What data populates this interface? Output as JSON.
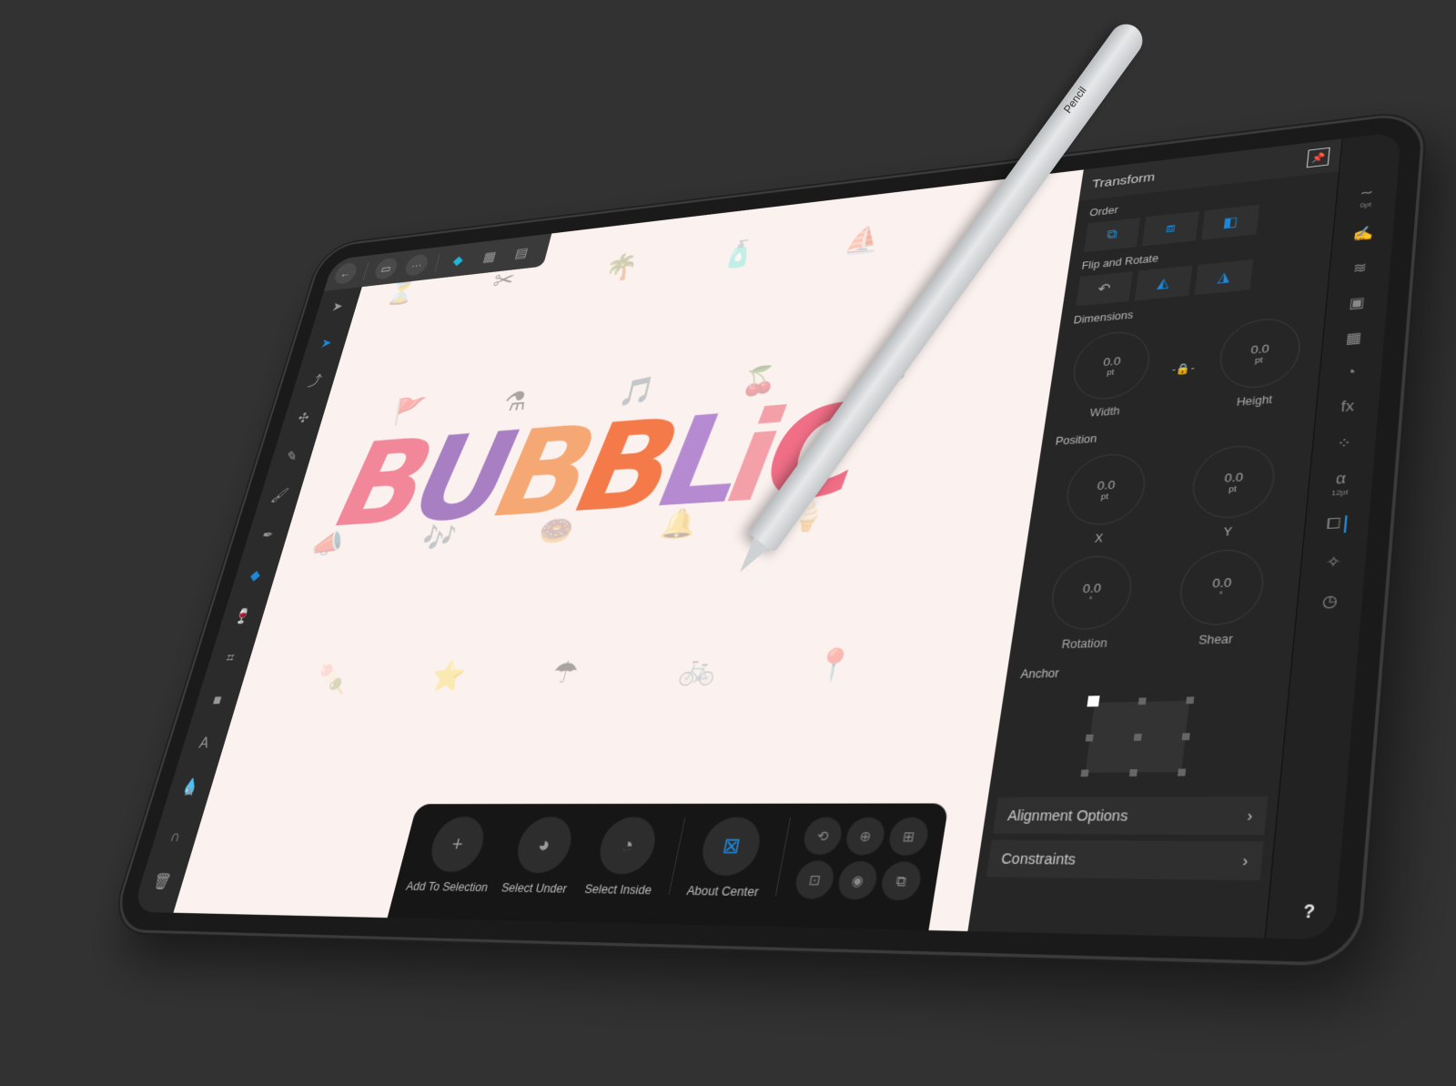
{
  "topbar": {
    "back_icon": "←",
    "document_icon": "▭",
    "more_icon": "···",
    "persona_designer_icon": "◆",
    "persona_pixel_icon": "▦",
    "persona_export_icon": "▤"
  },
  "left_tools": [
    {
      "name": "move-tool",
      "glyph": "➤",
      "active": false
    },
    {
      "name": "node-tool",
      "glyph": "➤",
      "active": true
    },
    {
      "name": "point-transform-tool",
      "glyph": "⤴",
      "active": false
    },
    {
      "name": "corner-tool",
      "glyph": "✣",
      "active": false
    },
    {
      "name": "pencil-tool",
      "glyph": "✎",
      "active": false
    },
    {
      "name": "vector-brush-tool",
      "glyph": "🖌",
      "active": false
    },
    {
      "name": "pen-tool",
      "glyph": "✒",
      "active": false
    },
    {
      "name": "fill-tool",
      "glyph": "◆",
      "active": true
    },
    {
      "name": "transparency-tool",
      "glyph": "🍷",
      "active": false
    },
    {
      "name": "crop-tool",
      "glyph": "⌗",
      "active": false
    },
    {
      "name": "shape-tool",
      "glyph": "■",
      "active": false
    },
    {
      "name": "text-tool",
      "glyph": "A",
      "active": false
    },
    {
      "name": "color-picker-tool",
      "glyph": "💧",
      "active": false
    }
  ],
  "left_bottom": {
    "close_icon": "✕",
    "snap_icon": "∩",
    "delete_icon": "🗑"
  },
  "canvas": {
    "artwork_text": [
      "B",
      "U",
      "B",
      "B",
      "L",
      "i",
      "C"
    ],
    "artwork_colors": [
      "#f2879a",
      "#a77fc2",
      "#f5a874",
      "#f57a4a",
      "#b58ad0",
      "#f3a0a8",
      "#f06e86"
    ],
    "background_icons": [
      "⏳",
      "✂",
      "🌴",
      "🧴",
      "⛵",
      "🚩",
      "⚗",
      "🎵",
      "🍒",
      "🎮",
      "📣",
      "🎶",
      "🍩",
      "🔔",
      "🍦",
      "🍡",
      "⭐",
      "☂",
      "🚲",
      "📍"
    ]
  },
  "context_toolbar": {
    "items": [
      {
        "icon": "+",
        "label": "Add To Selection"
      },
      {
        "icon": "◕",
        "label": "Select Under"
      },
      {
        "icon": "◔",
        "label": "Select Inside"
      },
      {
        "icon": "⊠",
        "label": "About Center"
      }
    ],
    "small_buttons": [
      "⟲",
      "⊕",
      "⊞",
      "⊡",
      "◉",
      "⧉"
    ]
  },
  "panel": {
    "title": "Transform",
    "pin_icon": "📌",
    "order_label": "Order",
    "order_buttons": [
      "⧉",
      "⧈",
      "◧"
    ],
    "flip_label": "Flip and Rotate",
    "flip_buttons": [
      "↶",
      "◭",
      "◮"
    ],
    "dimensions_label": "Dimensions",
    "width": {
      "value": "0.0",
      "unit": "pt",
      "name": "Width"
    },
    "height": {
      "value": "0.0",
      "unit": "pt",
      "name": "Height"
    },
    "lock_icon": "-🔒-",
    "position_label": "Position",
    "x": {
      "value": "0.0",
      "unit": "pt",
      "name": "X"
    },
    "y": {
      "value": "0.0",
      "unit": "pt",
      "name": "Y"
    },
    "rotation": {
      "value": "0.0",
      "unit": "°",
      "name": "Rotation"
    },
    "shear": {
      "value": "0.0",
      "unit": "°",
      "name": "Shear"
    },
    "anchor_label": "Anchor",
    "alignment_options": "Alignment Options",
    "constraints": "Constraints",
    "chevron": "›"
  },
  "studio_strip": [
    {
      "name": "stroke-icon",
      "glyph": "∼",
      "sub": "0pt"
    },
    {
      "name": "brushes-icon",
      "glyph": "✍",
      "sub": ""
    },
    {
      "name": "layers-icon",
      "glyph": "≋",
      "sub": ""
    },
    {
      "name": "appearance-icon",
      "glyph": "▣",
      "sub": ""
    },
    {
      "name": "swatches-icon",
      "glyph": "▦",
      "sub": ""
    },
    {
      "name": "color-icon",
      "glyph": "◔",
      "sub": ""
    },
    {
      "name": "effects-icon",
      "glyph": "fx",
      "sub": ""
    },
    {
      "name": "styles-icon",
      "glyph": "⁘",
      "sub": ""
    },
    {
      "name": "character-icon",
      "glyph": "α",
      "sub": "12pt"
    },
    {
      "name": "transform-icon",
      "glyph": "⧠",
      "sub": "",
      "active": true
    },
    {
      "name": "symbols-icon",
      "glyph": "✧",
      "sub": ""
    },
    {
      "name": "history-icon",
      "glyph": "◷",
      "sub": ""
    }
  ],
  "help_icon": "?",
  "pencil": {
    "brand": " Pencil"
  }
}
